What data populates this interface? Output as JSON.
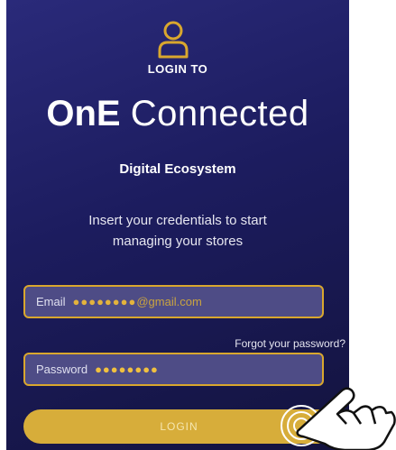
{
  "header": {
    "login_to": "LOGIN TO"
  },
  "brand": {
    "bold": "OnE",
    "light": "Connected"
  },
  "subtitle": "Digital Ecosystem",
  "intro": {
    "line1": "Insert your credentials to start",
    "line2": "managing your stores"
  },
  "email": {
    "label": "Email",
    "dots": "●●●●●●●●",
    "suffix": "@gmail.com"
  },
  "forgot": "Forgot your password?",
  "password": {
    "label": "Password",
    "dots": "●●●●●●●●"
  },
  "login_button": "LOGIN",
  "colors": {
    "accent": "#d7ad3a",
    "panel": "#1c1c5e",
    "field_bg": "#4e4c86"
  },
  "icons": [
    "user-icon",
    "tap-hand-icon"
  ]
}
